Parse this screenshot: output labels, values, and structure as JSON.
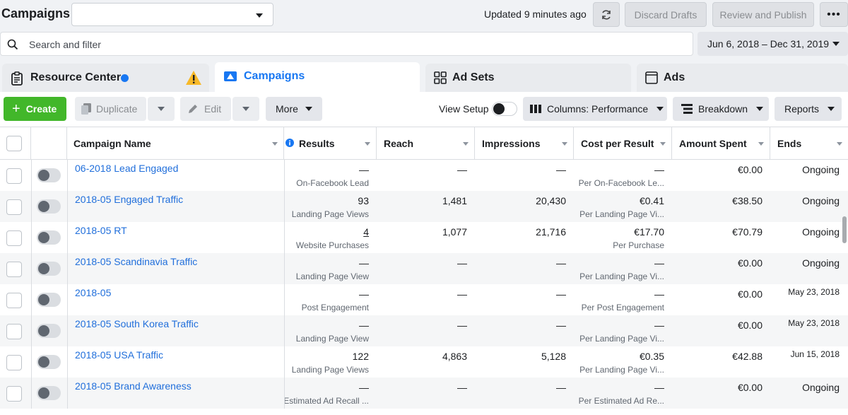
{
  "header": {
    "title": "Campaigns",
    "account_value": "",
    "updated": "Updated 9 minutes ago",
    "discard": "Discard Drafts",
    "review": "Review and Publish",
    "more": "•••"
  },
  "search": {
    "placeholder": "Search and filter",
    "date_range": "Jun 6, 2018 – Dec 31, 2019"
  },
  "tabs": [
    {
      "label": "Resource Center",
      "icon": "clipboard-icon",
      "badge_color": "#1877f2",
      "warning_color": "#f7b928"
    },
    {
      "label": "Campaigns",
      "icon": "campaign-flag-icon",
      "active": true
    },
    {
      "label": "Ad Sets",
      "icon": "grid-icon"
    },
    {
      "label": "Ads",
      "icon": "ad-window-icon"
    }
  ],
  "toolbar": {
    "create": "Create",
    "duplicate": "Duplicate",
    "edit": "Edit",
    "more": "More",
    "view_setup": "View Setup",
    "columns": "Columns: Performance",
    "breakdown": "Breakdown",
    "reports": "Reports"
  },
  "columns": [
    "Campaign Name",
    "Results",
    "Reach",
    "Impressions",
    "Cost per Result",
    "Amount Spent",
    "Ends"
  ],
  "rows": [
    {
      "name": "06-2018 Lead Engaged",
      "results": "—",
      "results_sub": "On-Facebook Lead",
      "reach": "—",
      "impressions": "—",
      "cpr": "—",
      "cpr_sub": "Per On-Facebook Le...",
      "spent": "€0.00",
      "ends": "Ongoing"
    },
    {
      "name": "2018-05 Engaged Traffic",
      "results": "93",
      "results_sub": "Landing Page Views",
      "reach": "1,481",
      "impressions": "20,430",
      "cpr": "€0.41",
      "cpr_sub": "Per Landing Page Vi...",
      "spent": "€38.50",
      "ends": "Ongoing"
    },
    {
      "name": "2018-05 RT",
      "results": "4",
      "results_sub": "Website Purchases",
      "reach": "1,077",
      "impressions": "21,716",
      "cpr": "€17.70",
      "cpr_sub": "Per Purchase",
      "spent": "€70.79",
      "ends": "Ongoing"
    },
    {
      "name": "2018-05 Scandinavia Traffic",
      "results": "—",
      "results_sub": "Landing Page View",
      "reach": "—",
      "impressions": "—",
      "cpr": "—",
      "cpr_sub": "Per Landing Page Vi...",
      "spent": "€0.00",
      "ends": "Ongoing"
    },
    {
      "name": "2018-05",
      "results": "—",
      "results_sub": "Post Engagement",
      "reach": "—",
      "impressions": "—",
      "cpr": "—",
      "cpr_sub": "Per Post Engagement",
      "spent": "€0.00",
      "ends": "May 23, 2018"
    },
    {
      "name": "2018-05 South Korea Traffic",
      "results": "—",
      "results_sub": "Landing Page View",
      "reach": "—",
      "impressions": "—",
      "cpr": "—",
      "cpr_sub": "Per Landing Page Vi...",
      "spent": "€0.00",
      "ends": "May 23, 2018"
    },
    {
      "name": "2018-05 USA Traffic",
      "results": "122",
      "results_sub": "Landing Page Views",
      "reach": "4,863",
      "impressions": "5,128",
      "cpr": "€0.35",
      "cpr_sub": "Per Landing Page Vi...",
      "spent": "€42.88",
      "ends": "Jun 15, 2018"
    },
    {
      "name": "2018-05 Brand Awareness",
      "results": "—",
      "results_sub": "Estimated Ad Recall ...",
      "reach": "—",
      "impressions": "—",
      "cpr": "—",
      "cpr_sub": "Per Estimated Ad Re...",
      "spent": "€0.00",
      "ends": "Ongoing"
    }
  ]
}
